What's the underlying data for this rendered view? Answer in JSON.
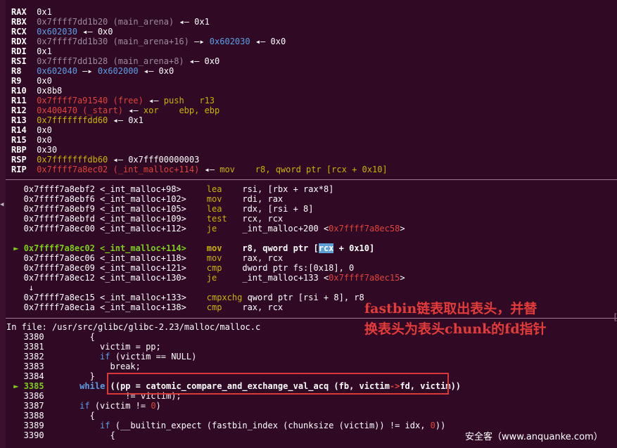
{
  "registers": [
    {
      "name": "RAX",
      "parts": [
        {
          "t": "0x1",
          "c": "white"
        }
      ]
    },
    {
      "name": "RBX",
      "parts": [
        {
          "t": "0x7ffff7dd1b20 (main_arena)",
          "c": "grey"
        },
        {
          "t": " ◂— 0x1",
          "c": "white"
        }
      ]
    },
    {
      "name": "RCX",
      "parts": [
        {
          "t": "0x602030",
          "c": "blue"
        },
        {
          "t": " ◂— 0x0",
          "c": "white"
        }
      ]
    },
    {
      "name": "RDX",
      "parts": [
        {
          "t": "0x7ffff7dd1b30 (main_arena+16)",
          "c": "grey"
        },
        {
          "t": " —▸ ",
          "c": "white"
        },
        {
          "t": "0x602030",
          "c": "blue"
        },
        {
          "t": " ◂— 0x0",
          "c": "white"
        }
      ]
    },
    {
      "name": "RDI",
      "parts": [
        {
          "t": "0x1",
          "c": "white"
        }
      ]
    },
    {
      "name": "RSI",
      "parts": [
        {
          "t": "0x7ffff7dd1b28 (main_arena+8)",
          "c": "grey"
        },
        {
          "t": " ◂— 0x0",
          "c": "white"
        }
      ]
    },
    {
      "name": "R8",
      "parts": [
        {
          "t": "0x602040",
          "c": "blue"
        },
        {
          "t": " —▸ ",
          "c": "white"
        },
        {
          "t": "0x602000",
          "c": "blue"
        },
        {
          "t": " ◂— 0x0",
          "c": "white"
        }
      ]
    },
    {
      "name": "R9",
      "parts": [
        {
          "t": "0x0",
          "c": "white"
        }
      ]
    },
    {
      "name": "R10",
      "parts": [
        {
          "t": "0x8b8",
          "c": "white"
        }
      ]
    },
    {
      "name": "R11",
      "parts": [
        {
          "t": "0x7ffff7a91540 (free)",
          "c": "red"
        },
        {
          "t": " ◂— ",
          "c": "white"
        },
        {
          "t": "push   r13",
          "c": "yellow"
        }
      ]
    },
    {
      "name": "R12",
      "parts": [
        {
          "t": "0x400470 (_start)",
          "c": "red"
        },
        {
          "t": " ◂— ",
          "c": "white"
        },
        {
          "t": "xor    ebp, ebp",
          "c": "yellow"
        }
      ]
    },
    {
      "name": "R13",
      "parts": [
        {
          "t": "0x7fffffffdd60",
          "c": "yellow"
        },
        {
          "t": " ◂— 0x1",
          "c": "white"
        }
      ]
    },
    {
      "name": "R14",
      "parts": [
        {
          "t": "0x0",
          "c": "white"
        }
      ]
    },
    {
      "name": "R15",
      "parts": [
        {
          "t": "0x0",
          "c": "white"
        }
      ]
    },
    {
      "name": "RBP",
      "parts": [
        {
          "t": "0x30",
          "c": "white"
        }
      ]
    },
    {
      "name": "RSP",
      "parts": [
        {
          "t": "0x7fffffffdb60",
          "c": "yellow"
        },
        {
          "t": " ◂— 0x7fff00000003",
          "c": "white"
        }
      ]
    },
    {
      "name": "RIP",
      "parts": [
        {
          "t": "0x7ffff7a8ec02 (_int_malloc+114)",
          "c": "red"
        },
        {
          "t": " ◂— ",
          "c": "white"
        },
        {
          "t": "mov    r8, qword ptr [rcx + 0x10]",
          "c": "yellow"
        }
      ]
    }
  ],
  "disasm": [
    {
      "parts": [
        {
          "t": "   0x7ffff7a8ebf2 <_int_malloc+98>     ",
          "c": "white"
        },
        {
          "t": "lea    ",
          "c": "yellow"
        },
        {
          "t": "rsi, [rbx + rax*8]",
          "c": "white"
        }
      ]
    },
    {
      "parts": [
        {
          "t": "   0x7ffff7a8ebf6 <_int_malloc+102>    ",
          "c": "white"
        },
        {
          "t": "mov    ",
          "c": "yellow"
        },
        {
          "t": "rdi, rax",
          "c": "white"
        }
      ]
    },
    {
      "parts": [
        {
          "t": "   0x7ffff7a8ebf9 <_int_malloc+105>    ",
          "c": "white"
        },
        {
          "t": "lea    ",
          "c": "yellow"
        },
        {
          "t": "rdx, [rsi + 8]",
          "c": "white"
        }
      ]
    },
    {
      "parts": [
        {
          "t": "   0x7ffff7a8ebfd <_int_malloc+109>    ",
          "c": "white"
        },
        {
          "t": "test   ",
          "c": "yellow"
        },
        {
          "t": "rcx, rcx",
          "c": "white"
        }
      ]
    },
    {
      "parts": [
        {
          "t": "   0x7ffff7a8ec00 <_int_malloc+112>    ",
          "c": "white"
        },
        {
          "t": "je     ",
          "c": "yellow"
        },
        {
          "t": "_int_malloc+200 <",
          "c": "white"
        },
        {
          "t": "0x7ffff7a8ec58",
          "c": "red"
        },
        {
          "t": ">",
          "c": "white"
        }
      ]
    },
    {
      "parts": [
        {
          "t": "",
          "c": "white"
        }
      ]
    },
    {
      "parts": [
        {
          "t": " ► ",
          "c": "green"
        },
        {
          "t": "0x7ffff7a8ec02 <_int_malloc+114>    ",
          "c": "green bold"
        },
        {
          "t": "mov    ",
          "c": "yellow bold"
        },
        {
          "t": "r8, qword ptr [",
          "c": "white bold"
        },
        {
          "t": "rcx",
          "c": "hl"
        },
        {
          "t": " + 0x10]",
          "c": "white bold"
        }
      ]
    },
    {
      "parts": [
        {
          "t": "   0x7ffff7a8ec06 <_int_malloc+118>    ",
          "c": "white"
        },
        {
          "t": "mov    ",
          "c": "yellow"
        },
        {
          "t": "rax, rcx",
          "c": "white"
        }
      ]
    },
    {
      "parts": [
        {
          "t": "   0x7ffff7a8ec09 <_int_malloc+121>    ",
          "c": "white"
        },
        {
          "t": "cmp    ",
          "c": "yellow"
        },
        {
          "t": "dword ptr fs:[0x18], 0",
          "c": "white"
        }
      ]
    },
    {
      "parts": [
        {
          "t": "   0x7ffff7a8ec12 <_int_malloc+130>    ",
          "c": "white"
        },
        {
          "t": "je     ",
          "c": "yellow"
        },
        {
          "t": "_int_malloc+133 <",
          "c": "white"
        },
        {
          "t": "0x7ffff7a8ec15",
          "c": "red"
        },
        {
          "t": ">",
          "c": "white"
        }
      ]
    },
    {
      "parts": [
        {
          "t": "    ↓",
          "c": "white"
        }
      ]
    },
    {
      "parts": [
        {
          "t": "   0x7ffff7a8ec15 <_int_malloc+133>    ",
          "c": "white"
        },
        {
          "t": "cmpxchg ",
          "c": "yellow"
        },
        {
          "t": "qword ptr [rsi + 8], r8",
          "c": "white"
        }
      ]
    },
    {
      "parts": [
        {
          "t": "   0x7ffff7a8ec1a <_int_malloc+138>    ",
          "c": "white"
        },
        {
          "t": "cmp    ",
          "c": "yellow"
        },
        {
          "t": "rax, rcx",
          "c": "white"
        }
      ]
    }
  ],
  "source_header": "In file: /usr/src/glibc/glibc-2.23/malloc/malloc.c",
  "source": [
    {
      "parts": [
        {
          "t": "   3380         {",
          "c": "white"
        }
      ]
    },
    {
      "parts": [
        {
          "t": "   3381           victim = pp;",
          "c": "white"
        }
      ]
    },
    {
      "parts": [
        {
          "t": "   3382           ",
          "c": "white"
        },
        {
          "t": "if",
          "c": "blue"
        },
        {
          "t": " (victim == NULL)",
          "c": "white"
        }
      ]
    },
    {
      "parts": [
        {
          "t": "   3383             ",
          "c": "white"
        },
        {
          "t": "break",
          "c": "white"
        },
        {
          "t": ";",
          "c": "white"
        }
      ]
    },
    {
      "parts": [
        {
          "t": "   3384         }",
          "c": "white"
        }
      ]
    },
    {
      "parts": [
        {
          "t": " ► ",
          "c": "green"
        },
        {
          "t": "3385",
          "c": "green bold"
        },
        {
          "t": "       ",
          "c": "white"
        },
        {
          "t": "while",
          "c": "blue bold"
        },
        {
          "t": " ((pp = catomic_compare_and_exchange_val_acq (fb, victim",
          "c": "white bold"
        },
        {
          "t": "->",
          "c": "red bold"
        },
        {
          "t": "fd, victim))",
          "c": "white bold"
        }
      ]
    },
    {
      "parts": [
        {
          "t": "   3386                ",
          "c": "white"
        },
        {
          "t": "!= victim);",
          "c": "white"
        }
      ]
    },
    {
      "parts": [
        {
          "t": "   3387       ",
          "c": "white"
        },
        {
          "t": "if",
          "c": "blue"
        },
        {
          "t": " (victim != ",
          "c": "white"
        },
        {
          "t": "0",
          "c": "red"
        },
        {
          "t": ")",
          "c": "white"
        }
      ]
    },
    {
      "parts": [
        {
          "t": "   3388         {",
          "c": "white"
        }
      ]
    },
    {
      "parts": [
        {
          "t": "   3389           ",
          "c": "white"
        },
        {
          "t": "if",
          "c": "blue"
        },
        {
          "t": " (__builtin_expect (fastbin_index (chunksize (victim)) != idx, ",
          "c": "white"
        },
        {
          "t": "0",
          "c": "red"
        },
        {
          "t": "))",
          "c": "white"
        }
      ]
    },
    {
      "parts": [
        {
          "t": "   3390             {",
          "c": "white"
        }
      ]
    }
  ],
  "annotation": {
    "line1": "fastbin链表取出表头，并替",
    "line2": "换表头为表头chunk的fd指针"
  },
  "watermark": "安全客（www.anquanke.com）",
  "colors": {
    "background": "#300a24",
    "red": "#e0433b",
    "yellow": "#c9b400",
    "blue": "#5c9ee6",
    "green": "#7fce1a",
    "grey": "#9c8aa0"
  }
}
